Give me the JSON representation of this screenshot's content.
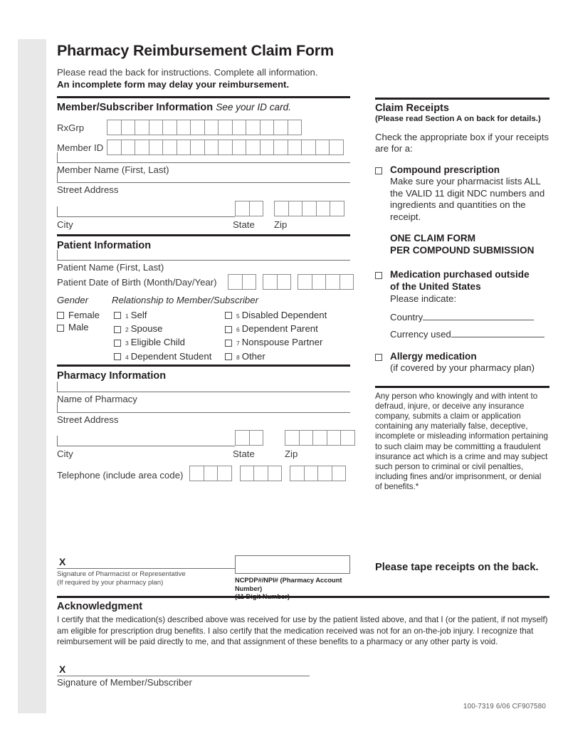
{
  "document": {
    "title": "Pharmacy Reimbursement Claim Form",
    "lead_line_1": "Please read the back for instructions. Complete all information.",
    "lead_line_2": "An incomplete form may delay your reimbursement.",
    "footer": "100-7319   6/06   CF907580"
  },
  "member_section": {
    "heading": "Member/Subscriber Information",
    "heading_italic": "See your ID card.",
    "rxgrp_label": "RxGrp",
    "rxgrp_boxes": 14,
    "member_id_label": "Member ID",
    "member_id_boxes": 17,
    "member_name_label": "Member Name (First, Last)",
    "street_label": "Street Address",
    "city_label": "City",
    "state_label": "State",
    "state_boxes": 2,
    "zip_label": "Zip",
    "zip_boxes": 5
  },
  "patient_section": {
    "heading": "Patient Information",
    "patient_name_label": "Patient Name (First, Last)",
    "dob_label": "Patient Date of Birth (Month/Day/Year)",
    "dob_groups": [
      2,
      2,
      4
    ],
    "gender_label": "Gender",
    "relationship_label": "Relationship to Member/Subscriber",
    "gender_options": [
      "Female",
      "Male"
    ],
    "relationship_col1": [
      {
        "num": "1",
        "label": "Self"
      },
      {
        "num": "2",
        "label": "Spouse"
      },
      {
        "num": "3",
        "label": "Eligible Child"
      },
      {
        "num": "4",
        "label": "Dependent Student"
      }
    ],
    "relationship_col2": [
      {
        "num": "5",
        "label": "Disabled Dependent"
      },
      {
        "num": "6",
        "label": "Dependent Parent"
      },
      {
        "num": "7",
        "label": "Nonspouse Partner"
      },
      {
        "num": "8",
        "label": "Other"
      }
    ]
  },
  "pharmacy_section": {
    "heading": "Pharmacy Information",
    "name_label": "Name of Pharmacy",
    "street_label": "Street Address",
    "city_label": "City",
    "state_label": "State",
    "state_boxes": 2,
    "zip_label": "Zip",
    "zip_boxes": 5,
    "telephone_label": "Telephone (include area code)",
    "telephone_groups": [
      3,
      3,
      4
    ]
  },
  "claim_receipts": {
    "heading": "Claim Receipts",
    "subheading": "(Please read Section A on back for details.)",
    "intro": "Check the appropriate box if your receipts are for a:",
    "option_compound_title": "Compound prescription",
    "option_compound_body": "Make sure your pharmacist lists ALL the VALID 11 digit NDC numbers and ingredients and quantities on the receipt.",
    "one_claim_line_1": "ONE CLAIM FORM",
    "one_claim_line_2": "PER COMPOUND SUBMISSION",
    "option_outside_title_1": "Medication purchased outside",
    "option_outside_title_2": "of the United States",
    "option_outside_body": "Please indicate:",
    "country_label": "Country",
    "currency_label": "Currency used",
    "option_allergy_title": "Allergy medication",
    "option_allergy_body": "(if covered by your pharmacy plan)",
    "fraud_notice": "Any person who knowingly and with intent to defraud, injure, or deceive any insurance company, submits a claim or application containing any materially false, deceptive, incomplete or misleading information pertaining to such claim may be committing a fraudulent insurance act which is a crime and may subject such person to criminal or civil penalties, including fines and/or imprisonment, or denial of benefits.*"
  },
  "signatures": {
    "x_mark": "X",
    "pharmacist_caption_1": "Signature of Pharmacist or Representative",
    "pharmacist_caption_2": "(If required by your pharmacy plan)",
    "ncpdp_caption_1": "NCPDP#/NPI# (Pharmacy Account Number)",
    "ncpdp_caption_2": "(11 Digit Number)",
    "tape_notice": "Please tape receipts on the back.",
    "member_caption": "Signature of Member/Subscriber"
  },
  "acknowledgment": {
    "heading": "Acknowledgment",
    "body": "I certify that the medication(s) described above was received for use by the patient listed above, and that I (or the patient, if not myself) am  eligible for prescription drug benefits. I also certify that the medication received was not for an on-the-job injury. I recognize that reimbursement will be paid directly to me, and that assignment of these benefits to a pharmacy or any other party is void."
  }
}
